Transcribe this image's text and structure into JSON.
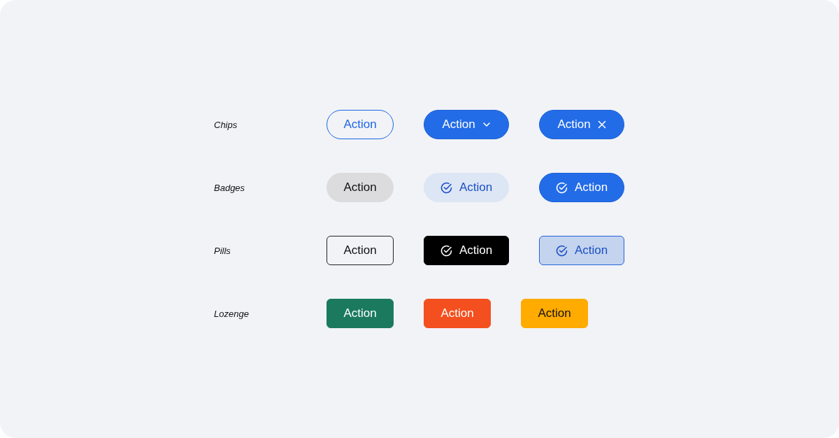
{
  "rows": [
    {
      "label": "Chips",
      "kind": "chip",
      "items": [
        {
          "text": "Action",
          "kind": "outline"
        },
        {
          "text": "Action",
          "kind": "dropdown"
        },
        {
          "text": "Action",
          "kind": "removable"
        }
      ]
    },
    {
      "label": "Badges",
      "kind": "badge",
      "items": [
        {
          "text": "Action",
          "kind": "neutral"
        },
        {
          "text": "Action",
          "kind": "soft-check"
        },
        {
          "text": "Action",
          "kind": "solid-check"
        }
      ]
    },
    {
      "label": "Pills",
      "kind": "pill",
      "items": [
        {
          "text": "Action",
          "kind": "outline-dark"
        },
        {
          "text": "Action",
          "kind": "black-check"
        },
        {
          "text": "Action",
          "kind": "tinted-check"
        }
      ]
    },
    {
      "label": "Lozenge",
      "kind": "lozenge",
      "items": [
        {
          "text": "Action",
          "kind": "colored",
          "color": "#1b7a5e"
        },
        {
          "text": "Action",
          "kind": "colored",
          "color": "#f44f1e"
        },
        {
          "text": "Action",
          "kind": "colored",
          "color": "#ffab00"
        }
      ]
    }
  ]
}
